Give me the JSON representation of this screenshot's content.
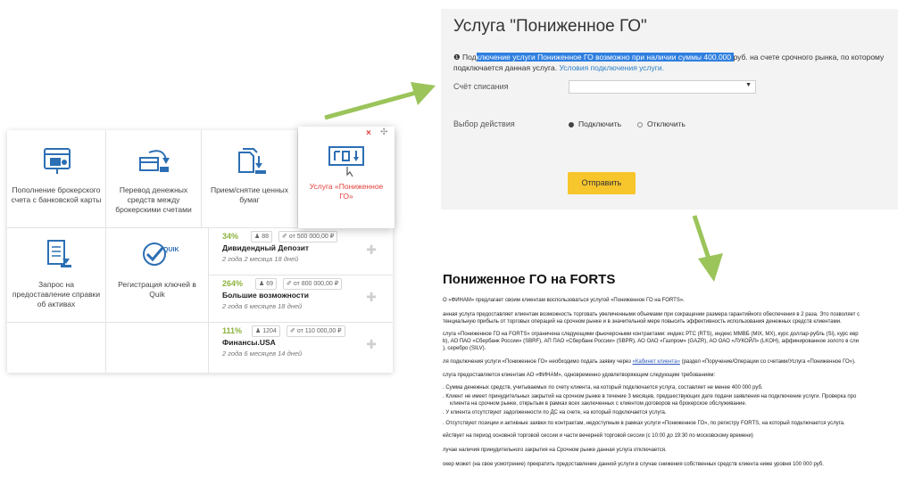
{
  "tiles": [
    {
      "label": "Пополнение брокерского счета с банковской карты",
      "icon": "card-icon"
    },
    {
      "label": "Перевод денежных средств между брокерскими счетами",
      "icon": "transfer-icon"
    },
    {
      "label": "Прием/снятие ценных бумаг",
      "icon": "securities-icon"
    },
    {
      "label": "Услуга «Пониженное ГО»",
      "icon": "go-icon"
    },
    {
      "label": "Запрос на предоставление справки об активах",
      "icon": "document-icon"
    },
    {
      "label": "Регистрация ключей в Quik",
      "icon": "quik-key-icon"
    }
  ],
  "products": [
    {
      "percent": "34%",
      "users": "88",
      "min": "от 500 000,00 ₽",
      "name": "Дивидендный Депозит",
      "term": "2 года 2 месяца 18 дней"
    },
    {
      "percent": "264%",
      "users": "69",
      "min": "от 800 000,00 ₽",
      "name": "Большие возможности",
      "term": "2 года 6 месяцев 18 дней"
    },
    {
      "percent": "111%",
      "users": "1204",
      "min": "от 110 000,00 ₽",
      "name": "Финансы.USA",
      "term": "2 года 6 месяцев 14 дней"
    }
  ],
  "form": {
    "title": "Услуга \"Пониженное ГО\"",
    "info_pre": "Под",
    "info_hl": "ключение услуги Пониженное ГО возможно при наличии суммы 400.000 ",
    "info_post": "руб. на счете срочного рынка, по которому подключается данная услуга.",
    "info_link": "Условия подключения услуги.",
    "account_label": "Счёт списания",
    "action_label": "Выбор действия",
    "radio_on": "Подключить",
    "radio_off": "Отключить",
    "submit": "Отправить"
  },
  "doc": {
    "title": "Пониженное ГО на FORTS",
    "lines": [
      "О «ФИНАМ» предлагает своим клиентам воспользоваться услугой «Пониженное ГО на FORTS».",
      "анная услуга предоставляет клиентам возможность торговать увеличенными объемами при сокращении размера гарантийного обеспечения в 2 раза. Это позволяет с",
      "тенциальную прибыль от торговых операций на срочном рынке и в значительной мере повысить эффективность использования денежных средств клиентами.",
      "слуга «Пониженное ГО на FORTS» ограничена следующими фьючерсными контрактами: индекс РТС (RTS), индекс ММВБ (MIX, MX), курс доллар-рубль (Si), курс евр",
      "b), АО ПАО «Сбербанк России» (SBRF), АП ПАО «Сбербанк России» (SBPR), АО ОАО «Газпром» (GAZR), АО ОАО «ЛУКОЙЛ» (LKOH), аффинированное золото в сли",
      "), серебро (SILV).",
      "ля подключения услуги «Пониженное ГО» необходимо подать заявку через",
      "«Кабинет клиента»",
      " (раздел «Поручение/Операции со счетами/Услуга «Пониженное ГО»).",
      "слуга предоставляется клиентам АО «ФИНАМ», одновременно удовлетворяющим следующим требованиям:",
      ". Сумма денежных средств, учитываемых по счету клиента, на который подключается услуга, составляет не менее 400 000 руб.",
      ". Клиент не имеет принудительных закрытий на срочном рынке в течение 3 месяцев, предшествующих дате подачи заявления на подключение услуги. Проверка про",
      "клиента на срочном рынке, открытым в рамках всех заключенных с клиентом договоров на брокерское обслуживание.",
      ". У клиента отсутствуют задолженности по ДС на счете, на который подключается услуга.",
      ". Отсутствуют позиции и активные заявки по контрактам, недоступным в рамках услуги «Пониженное ГО», по регистру FORTS, на который подключается услуга.",
      "ействует на период основной торговой сессии и части вечерней торговой сессии (с 10:00 до 19:30 по московскому времени)",
      "лучае наличия принудительного закрытия на Срочном рынке данная услуга отключается.",
      "окер может (на свое усмотрение) прекратить предоставление данной услуги в случае снижения собственных средств клиента ниже уровня 100 000 руб."
    ]
  },
  "colors": {
    "accent_green": "#8db33f",
    "arrow_green": "#9bc45a",
    "active_red": "#e2413c",
    "icon_blue": "#2c6fb4",
    "button_yellow": "#f7c52c"
  }
}
